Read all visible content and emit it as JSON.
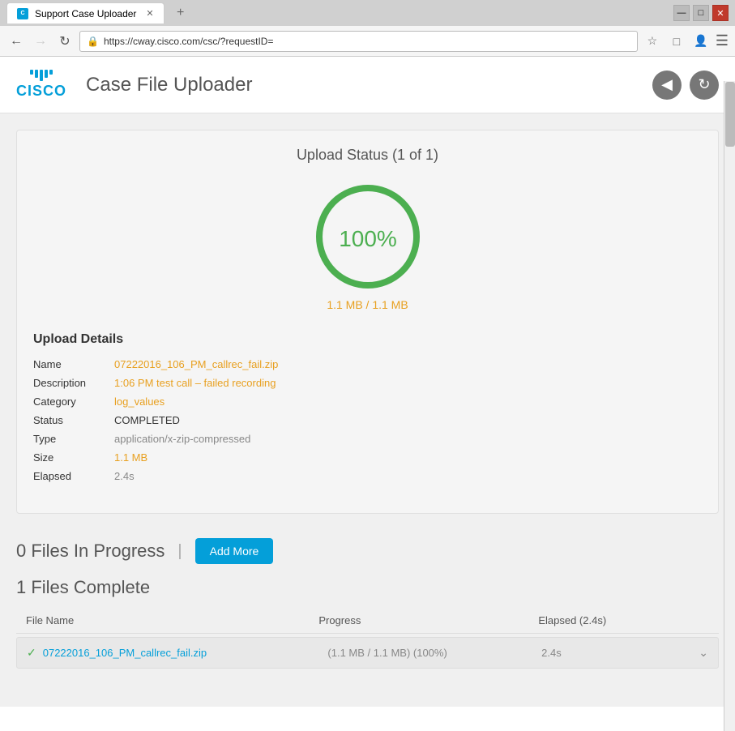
{
  "window": {
    "title": "Support Case Uploader"
  },
  "browser": {
    "tab_label": "Support Case Uploader",
    "url": "https://cway.cisco.com/csc/?requestID=",
    "back_btn": "←",
    "forward_btn": "→",
    "reload_btn": "↻"
  },
  "header": {
    "app_title": "Case File Uploader",
    "cisco_text": "CISCO"
  },
  "upload": {
    "status_title": "Upload Status (1 of 1)",
    "percentage": "100%",
    "file_size": "1.1 MB / 1.1 MB",
    "details_title": "Upload Details",
    "details": {
      "name_label": "Name",
      "name_value": "07222016_106_PM_callrec_fail.zip",
      "description_label": "Description",
      "description_value": "1:06 PM test call – failed recording",
      "category_label": "Category",
      "category_value": "log_values",
      "status_label": "Status",
      "status_value": "COMPLETED",
      "type_label": "Type",
      "type_value": "application/x-zip-compressed",
      "size_label": "Size",
      "size_value": "1.1 MB",
      "elapsed_label": "Elapsed",
      "elapsed_value": "2.4s"
    }
  },
  "bottom": {
    "files_in_progress": "0 Files In Progress",
    "add_more_label": "Add More",
    "files_complete": "1 Files Complete",
    "table": {
      "col_name": "File Name",
      "col_progress": "Progress",
      "col_elapsed": "Elapsed (2.4s)"
    },
    "file_row": {
      "name": "07222016_106_PM_callrec_fail.zip",
      "progress": "(1.1 MB / 1.1 MB) (100%)",
      "elapsed": "2.4s"
    }
  },
  "colors": {
    "cisco_blue": "#049fd9",
    "green": "#4caf50",
    "orange": "#e8a020",
    "gray_text": "#555555"
  }
}
